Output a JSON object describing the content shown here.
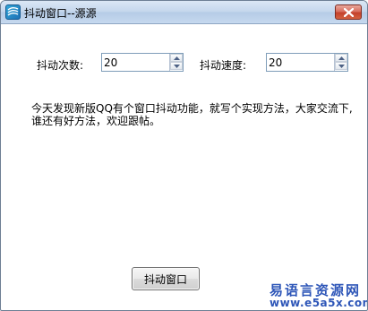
{
  "window": {
    "title": "抖动窗口--源源",
    "icon": "app-logo-icon",
    "close_icon": "close-icon",
    "close_color": "#c4412c"
  },
  "form": {
    "shake_count_label": "抖动次数:",
    "shake_count_value": "20",
    "shake_speed_label": "抖动速度:",
    "shake_speed_value": "20"
  },
  "description": {
    "line1": "今天发现新版QQ有个窗口抖动功能，就写个实现方法，大家交流下,",
    "line2": "谁还有好方法，欢迎跟帖。"
  },
  "buttons": {
    "shake_window": "抖动窗口"
  },
  "watermark": {
    "title": "易语言资源网",
    "url": "www.e5a5x.com",
    "color": "#2e56b8"
  }
}
